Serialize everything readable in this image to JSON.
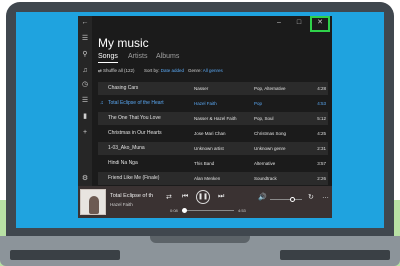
{
  "app": {
    "title": "My music",
    "titlebar": {
      "back_icon": "arrow-left-icon",
      "minimize_icon": "minimize-icon",
      "maximize_icon": "maximize-icon",
      "close_icon": "close-icon",
      "close_highlight_color": "#2fd14a"
    },
    "nav_rail_icons": [
      "hamburger-icon",
      "search-icon",
      "music-note-icon",
      "clock-icon",
      "list-icon",
      "now-playing-icon",
      "plus-icon",
      "settings-icon"
    ]
  },
  "tabs": [
    {
      "label": "Songs",
      "active": true
    },
    {
      "label": "Artists",
      "active": false
    },
    {
      "label": "Albums",
      "active": false
    }
  ],
  "filters": {
    "shuffle": "Shuffle all (122)",
    "sort_label": "Sort by:",
    "sort_value": "Date added",
    "genre_label": "Genre:",
    "genre_value": "All genres"
  },
  "songs": [
    {
      "title": "Chasing Cars",
      "artist": "Nasser",
      "genre": "Pop, Alternative",
      "duration": "4:28",
      "playing": false
    },
    {
      "title": "Total Eclipse of the Heart",
      "artist": "Hazel Faith",
      "genre": "Pop",
      "duration": "4:53",
      "playing": true
    },
    {
      "title": "The One That You Love",
      "artist": "Nasser & Hazel Faith",
      "genre": "Pop, Soul",
      "duration": "5:12",
      "playing": false
    },
    {
      "title": "Christmas in Our Hearts",
      "artist": "Jose Mari Chan",
      "genre": "Christmas Song",
      "duration": "4:25",
      "playing": false
    },
    {
      "title": "1-03_Ako_Muna",
      "artist": "Unknown artist",
      "genre": "Unknown genre",
      "duration": "2:31",
      "playing": false
    },
    {
      "title": "Hindi Na Nga",
      "artist": "This Band",
      "genre": "Alternative",
      "duration": "3:57",
      "playing": false
    },
    {
      "title": "Friend Like Me (Finale)",
      "artist": "Alan Menken",
      "genre": "Soundtrack",
      "duration": "2:26",
      "playing": false
    }
  ],
  "player": {
    "now_title": "Total Eclipse of th",
    "now_artist": "Hazel Faith",
    "elapsed": "0:08",
    "total": "4:53",
    "seek_progress": 0.05,
    "volume_level": 0.7,
    "accent": "#5aa8f3"
  }
}
